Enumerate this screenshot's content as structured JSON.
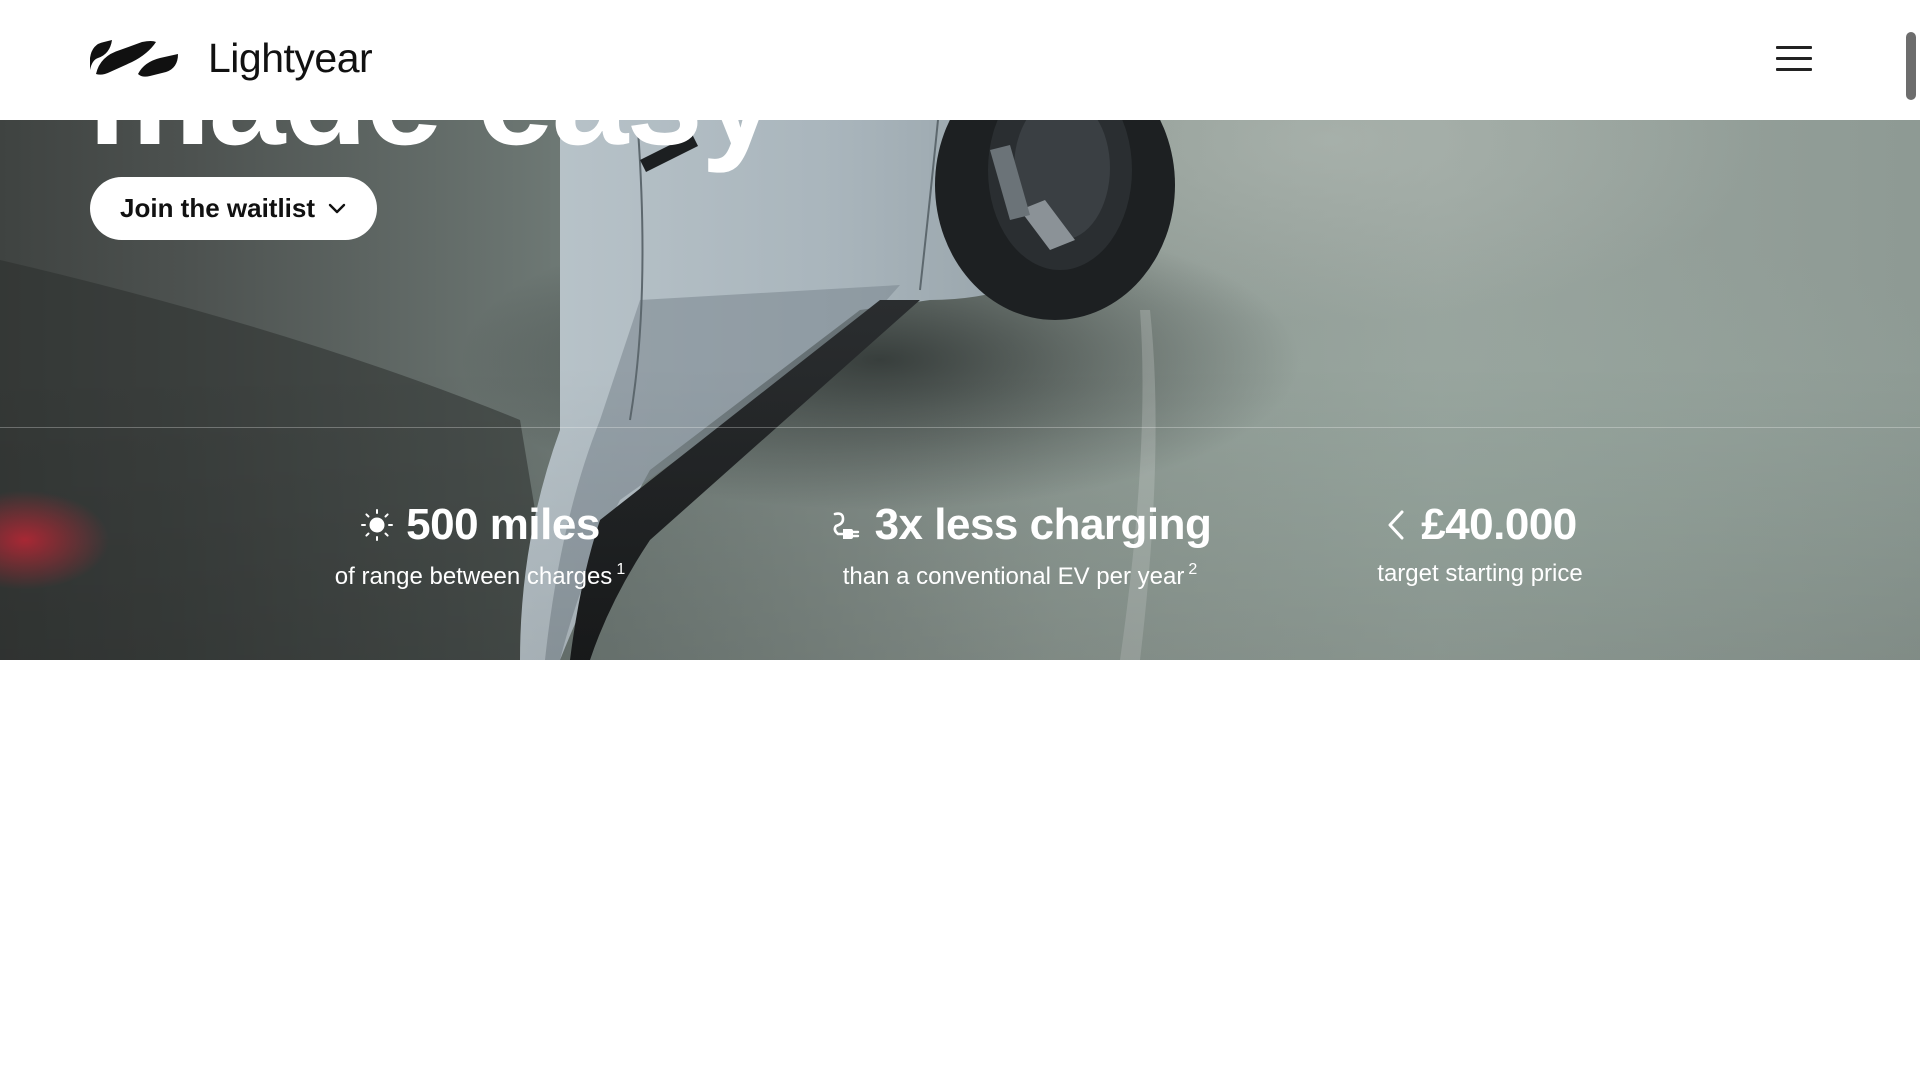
{
  "header": {
    "brand_name": "Lightyear",
    "logo_icon": "lightyear-logo-icon",
    "menu_icon": "hamburger-menu-icon"
  },
  "hero": {
    "headline_visible": "made easy",
    "cta_label": "Join the waitlist",
    "cta_icon": "chevron-down-icon"
  },
  "stats": [
    {
      "icon": "sun-icon",
      "value": "500 miles",
      "caption": "of range between charges",
      "footnote": "1"
    },
    {
      "icon": "charging-plug-icon",
      "value": "3x less charging",
      "caption": "than a conventional EV per year",
      "footnote": "2"
    },
    {
      "icon": "chevron-left-icon",
      "value": "£40.000",
      "caption": "target starting price",
      "footnote": ""
    }
  ],
  "colors": {
    "header_bg": "#ffffff",
    "text_dark": "#111111",
    "hero_text": "#ffffff",
    "hero_bg": "#8d9892",
    "page_bg": "#ffffff"
  }
}
